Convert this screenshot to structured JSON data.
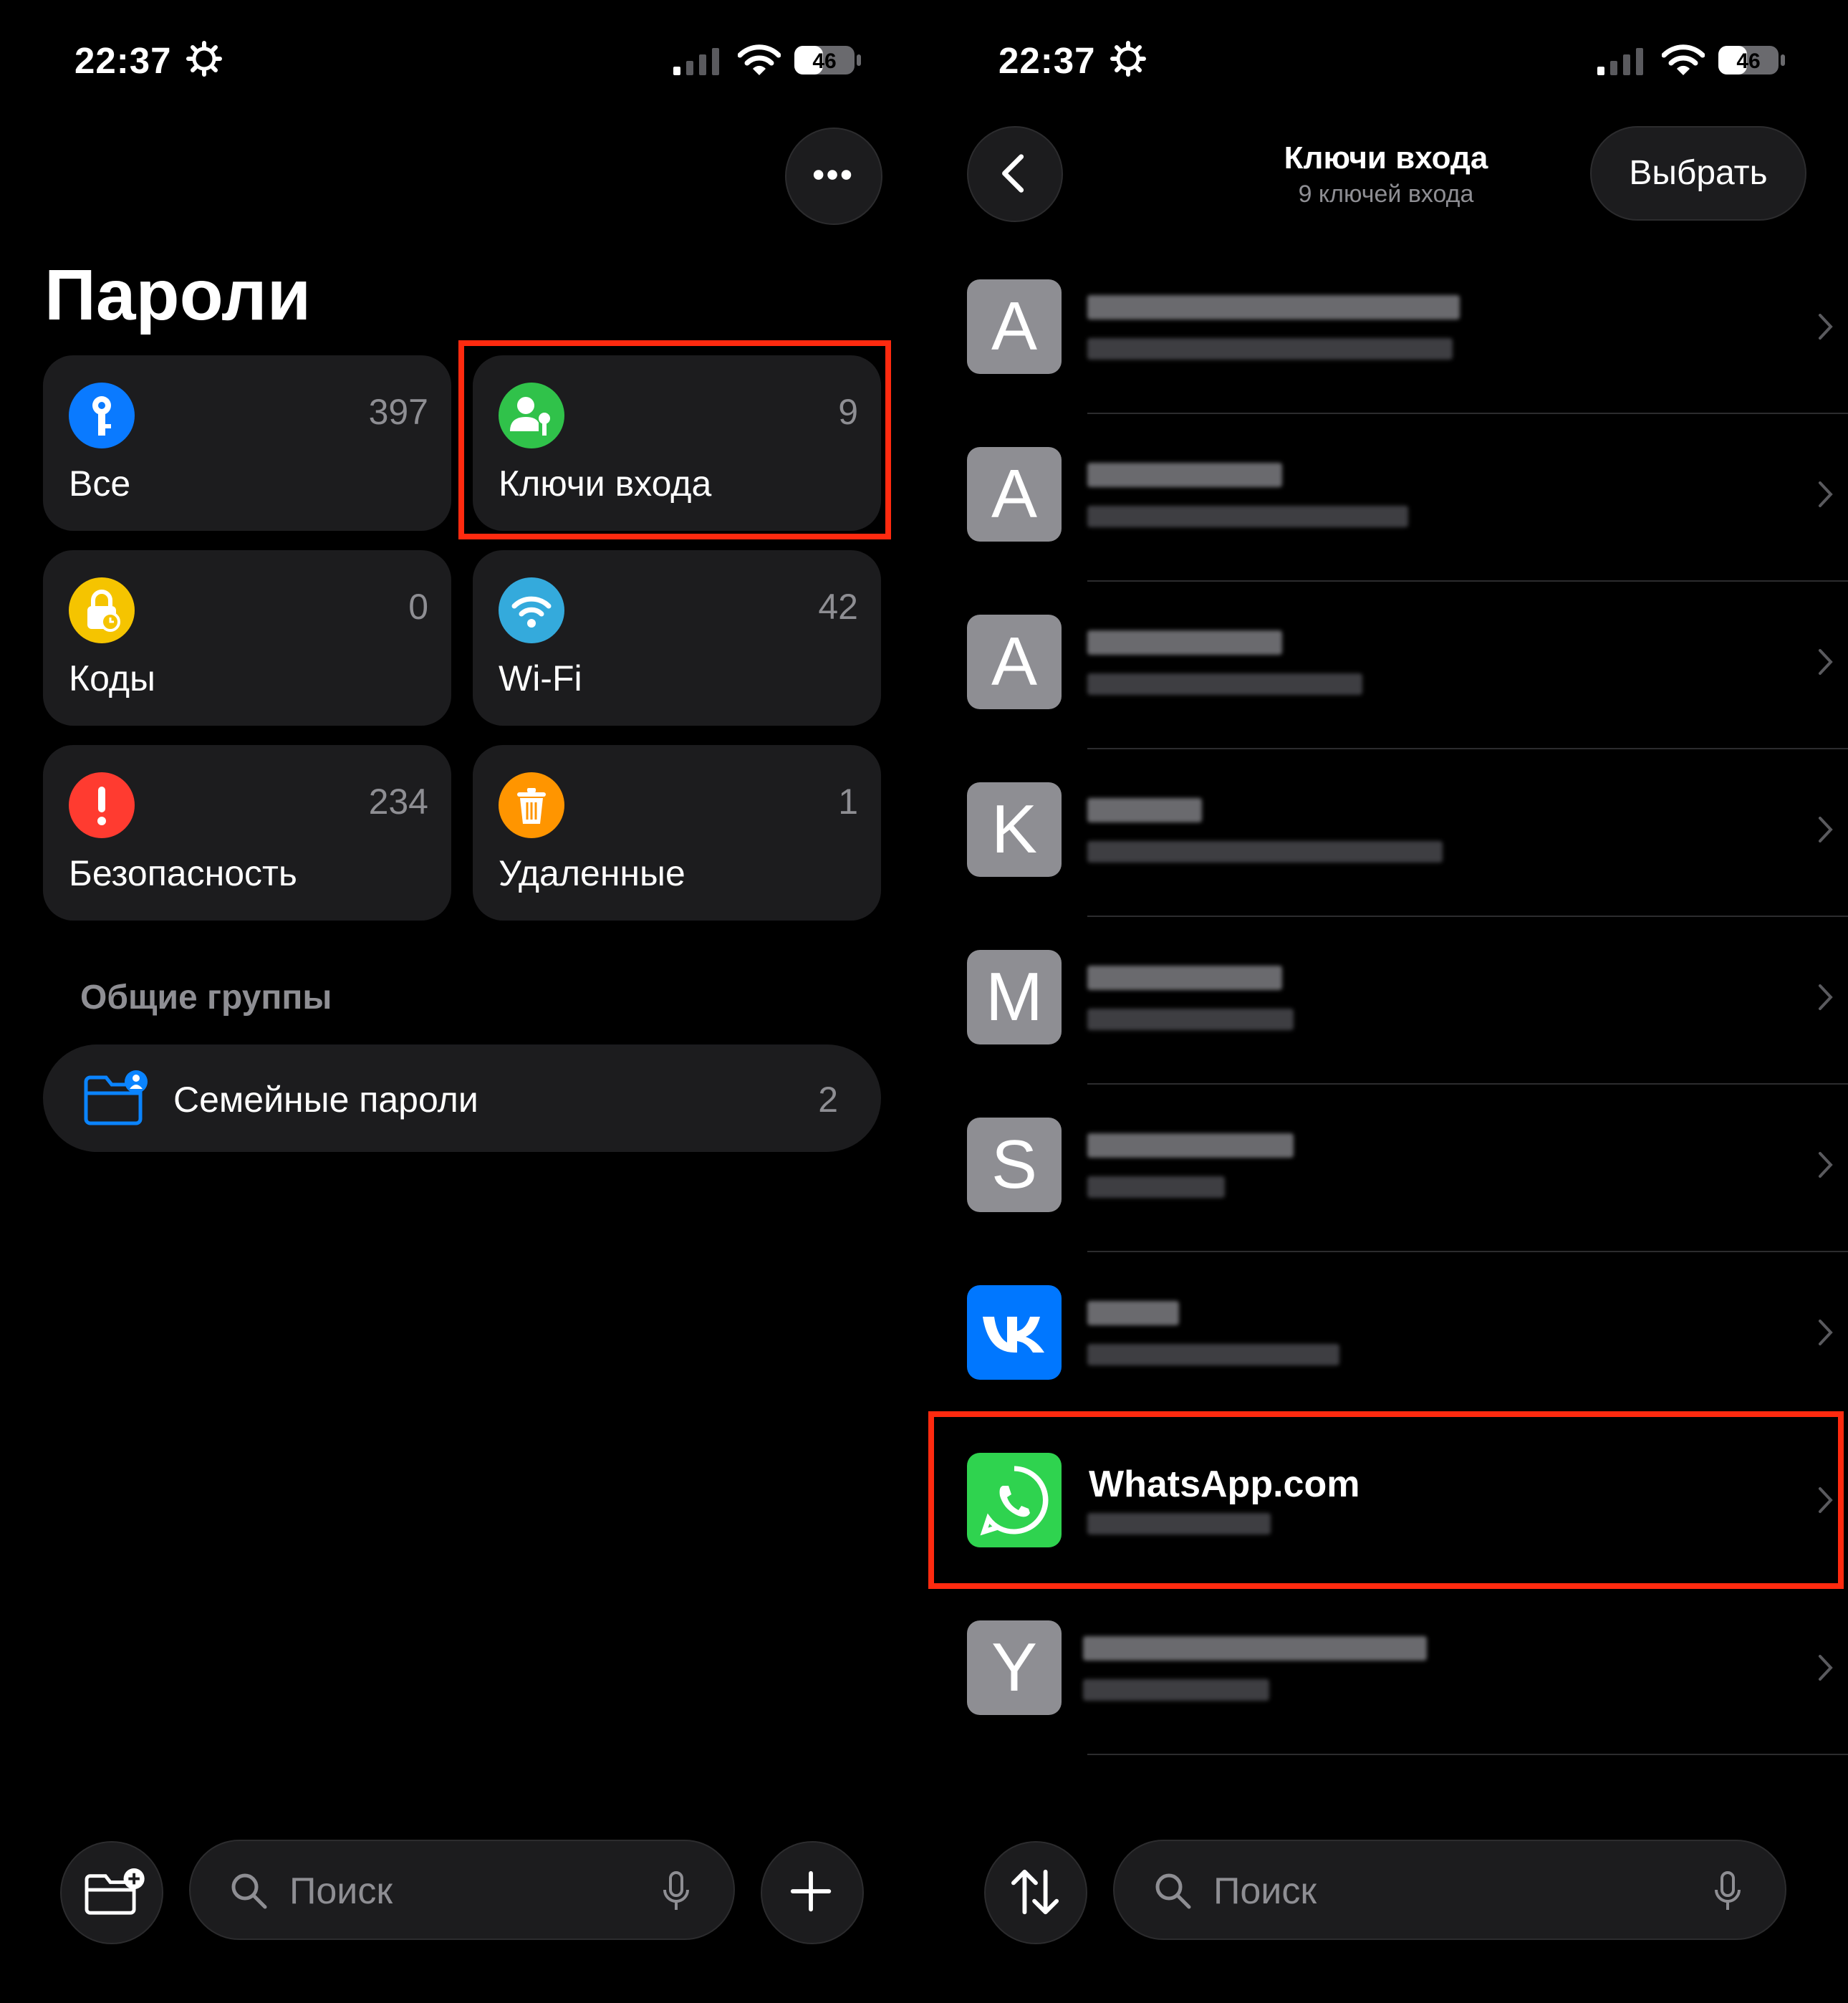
{
  "left": {
    "status": {
      "time": "22:37",
      "battery": "46"
    },
    "title": "Пароли",
    "tiles": [
      {
        "label": "Все",
        "count": "397",
        "icon": "key-icon",
        "color": "#0a7aff"
      },
      {
        "label": "Ключи входа",
        "count": "9",
        "icon": "passkey-icon",
        "color": "#30c24a"
      },
      {
        "label": "Коды",
        "count": "0",
        "icon": "lock-clock-icon",
        "color": "#f5c400"
      },
      {
        "label": "Wi-Fi",
        "count": "42",
        "icon": "wifi-icon",
        "color": "#34aadc"
      },
      {
        "label": "Безопасность",
        "count": "234",
        "icon": "exclamation-icon",
        "color": "#ff3b30"
      },
      {
        "label": "Удаленные",
        "count": "1",
        "icon": "trash-icon",
        "color": "#ff9500"
      }
    ],
    "shared_header": "Общие группы",
    "shared_group": {
      "label": "Семейные пароли",
      "count": "2"
    },
    "search_placeholder": "Поиск"
  },
  "right": {
    "status": {
      "time": "22:37",
      "battery": "46"
    },
    "nav_title": "Ключи входа",
    "nav_subtitle": "9 ключей входа",
    "select_label": "Выбрать",
    "items": [
      {
        "letter": "A"
      },
      {
        "letter": "A"
      },
      {
        "letter": "A"
      },
      {
        "letter": "K"
      },
      {
        "letter": "M"
      },
      {
        "letter": "S"
      },
      {
        "letter": "",
        "icon": "vk-icon"
      },
      {
        "letter": "",
        "icon": "whatsapp-icon",
        "name": "WhatsApp.com"
      },
      {
        "letter": "Y"
      }
    ],
    "search_placeholder": "Поиск"
  },
  "colors": {
    "highlight": "#ff2a0f",
    "tile_bg": "#1c1c1e",
    "secondary_text": "#8e8e93"
  }
}
